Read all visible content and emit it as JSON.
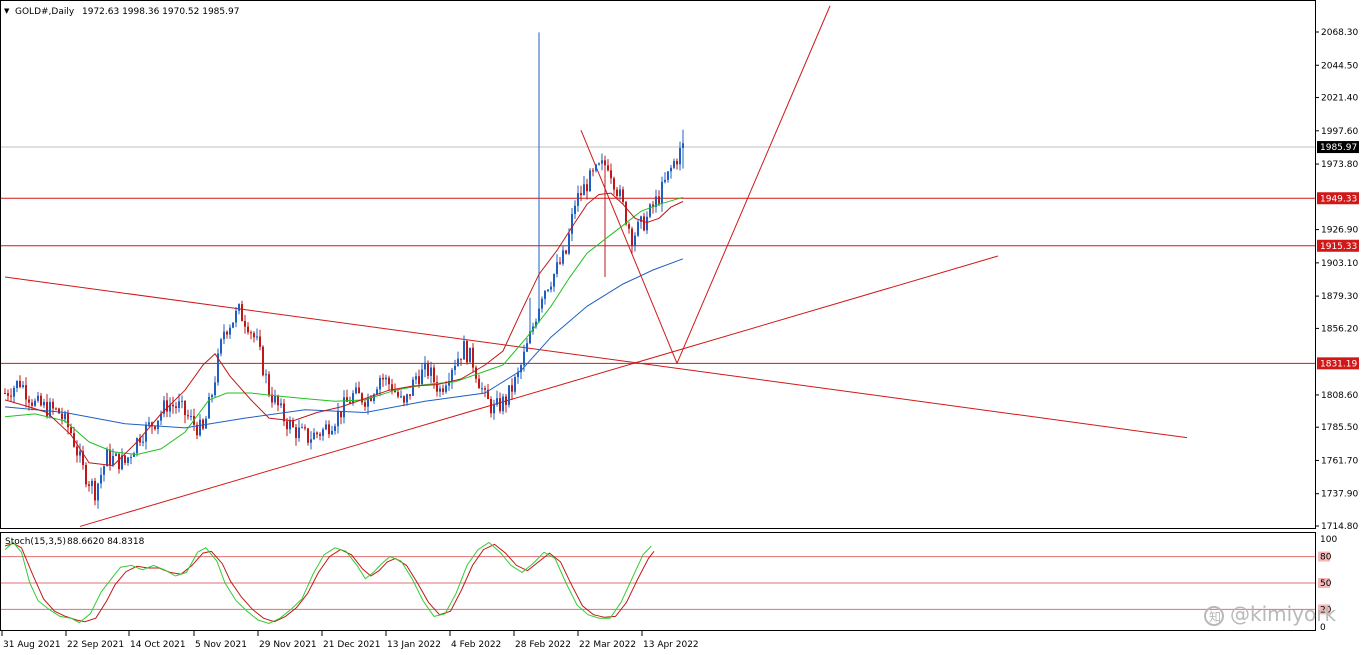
{
  "header": {
    "symbol": "GOLD#,Daily",
    "ohlc": "1972.63 1998.36 1970.52 1985.97",
    "dropdown_glyph": "▼"
  },
  "indicator": {
    "label": "Stoch(15,3,5)",
    "values": "88.6620 84.8318",
    "ticks": [
      "100",
      "80",
      "50",
      "20",
      "0"
    ]
  },
  "watermark": {
    "text": "@kimiyork",
    "logo_icon": "zhihu-circle-icon"
  },
  "colors": {
    "bull": "#1f5fc2",
    "bear": "#c01818",
    "level_line": "#d01818",
    "ma_fast": "#c01818",
    "ma_mid": "#22c022",
    "ma_slow": "#1f5fc2",
    "stoch_main": "#33cc33",
    "stoch_signal": "#c01818",
    "stoch_level": "#e07070"
  },
  "chart_data": [
    {
      "type": "candlestick",
      "ylim": [
        1714.8,
        2068.3
      ],
      "y_ticks": [
        "2068.30",
        "2044.50",
        "2021.40",
        "1997.60",
        "1973.80",
        "1949.33",
        "1926.90",
        "1903.10",
        "1879.30",
        "1856.20",
        "1831.19",
        "1808.60",
        "1785.50",
        "1761.70",
        "1737.90",
        "1714.80"
      ],
      "current_price": {
        "value": 1985.97,
        "label": "1985.97"
      },
      "levels": [
        {
          "value": 1949.33,
          "label": "1949.33"
        },
        {
          "value": 1915.33,
          "label": "1915.33"
        },
        {
          "value": 1831.19,
          "label": "1831.19"
        }
      ],
      "x_labels": [
        "31 Aug 2021",
        "22 Sep 2021",
        "14 Oct 2021",
        "5 Nov 2021",
        "29 Nov 2021",
        "21 Dec 2021",
        "13 Jan 2022",
        "4 Feb 2022",
        "28 Feb 2022",
        "22 Mar 2022",
        "13 Apr 2022"
      ],
      "trend_lines": [
        {
          "name": "descending",
          "from": {
            "bar": 0,
            "y": 1893.0
          },
          "to": {
            "bar": 394,
            "y": 1778.0
          }
        },
        {
          "name": "ascending",
          "from": {
            "bar": 25,
            "y": 1714.5
          },
          "to": {
            "bar": 331,
            "y": 1908.0
          }
        },
        {
          "name": "projection-down",
          "from": {
            "bar": 192,
            "y": 1998.0
          },
          "to": {
            "bar": 224,
            "y": 1831.19
          }
        },
        {
          "name": "projection-up",
          "from": {
            "bar": 224,
            "y": 1831.19
          },
          "to": {
            "bar": 275,
            "y": 2087.0
          }
        }
      ],
      "ma_fast": [
        [
          0,
          1805
        ],
        [
          8,
          1800
        ],
        [
          14,
          1796
        ],
        [
          22,
          1780
        ],
        [
          28,
          1760
        ],
        [
          36,
          1758
        ],
        [
          44,
          1775
        ],
        [
          52,
          1795
        ],
        [
          60,
          1812
        ],
        [
          66,
          1830
        ],
        [
          70,
          1838
        ],
        [
          75,
          1822
        ],
        [
          82,
          1805
        ],
        [
          88,
          1792
        ],
        [
          96,
          1790
        ],
        [
          104,
          1796
        ],
        [
          112,
          1800
        ],
        [
          120,
          1806
        ],
        [
          128,
          1812
        ],
        [
          136,
          1815
        ],
        [
          144,
          1816
        ],
        [
          152,
          1820
        ],
        [
          160,
          1830
        ],
        [
          166,
          1840
        ],
        [
          172,
          1868
        ],
        [
          178,
          1895
        ],
        [
          184,
          1912
        ],
        [
          190,
          1932
        ],
        [
          194,
          1945
        ],
        [
          198,
          1952
        ],
        [
          202,
          1953
        ],
        [
          206,
          1945
        ],
        [
          210,
          1935
        ],
        [
          214,
          1932
        ],
        [
          218,
          1935
        ],
        [
          222,
          1943
        ],
        [
          226,
          1947
        ]
      ],
      "ma_mid": [
        [
          0,
          1793
        ],
        [
          10,
          1795
        ],
        [
          20,
          1790
        ],
        [
          28,
          1775
        ],
        [
          36,
          1768
        ],
        [
          44,
          1766
        ],
        [
          52,
          1770
        ],
        [
          60,
          1782
        ],
        [
          68,
          1805
        ],
        [
          74,
          1810
        ],
        [
          82,
          1810
        ],
        [
          90,
          1808
        ],
        [
          100,
          1806
        ],
        [
          110,
          1804
        ],
        [
          120,
          1805
        ],
        [
          130,
          1812
        ],
        [
          140,
          1816
        ],
        [
          150,
          1818
        ],
        [
          158,
          1824
        ],
        [
          166,
          1830
        ],
        [
          174,
          1850
        ],
        [
          182,
          1872
        ],
        [
          188,
          1892
        ],
        [
          194,
          1910
        ],
        [
          200,
          1920
        ],
        [
          206,
          1930
        ],
        [
          212,
          1940
        ],
        [
          218,
          1945
        ],
        [
          226,
          1950
        ]
      ],
      "ma_slow": [
        [
          0,
          1800
        ],
        [
          20,
          1796
        ],
        [
          40,
          1788
        ],
        [
          60,
          1785
        ],
        [
          80,
          1792
        ],
        [
          100,
          1798
        ],
        [
          120,
          1796
        ],
        [
          140,
          1804
        ],
        [
          160,
          1810
        ],
        [
          172,
          1826
        ],
        [
          182,
          1850
        ],
        [
          194,
          1872
        ],
        [
          206,
          1888
        ],
        [
          216,
          1898
        ],
        [
          226,
          1906
        ]
      ],
      "bars": {
        "count": 227,
        "anchors": [
          [
            0,
            1810
          ],
          [
            5,
            1818
          ],
          [
            10,
            1802
          ],
          [
            18,
            1796
          ],
          [
            22,
            1782
          ],
          [
            26,
            1755
          ],
          [
            30,
            1740
          ],
          [
            34,
            1764
          ],
          [
            40,
            1760
          ],
          [
            45,
            1780
          ],
          [
            50,
            1790
          ],
          [
            54,
            1802
          ],
          [
            58,
            1800
          ],
          [
            62,
            1790
          ],
          [
            66,
            1782
          ],
          [
            69,
            1810
          ],
          [
            73,
            1855
          ],
          [
            78,
            1868
          ],
          [
            81,
            1860
          ],
          [
            84,
            1845
          ],
          [
            88,
            1812
          ],
          [
            93,
            1792
          ],
          [
            96,
            1784
          ],
          [
            101,
            1778
          ],
          [
            106,
            1783
          ],
          [
            110,
            1792
          ],
          [
            116,
            1808
          ],
          [
            121,
            1806
          ],
          [
            125,
            1822
          ],
          [
            129,
            1815
          ],
          [
            133,
            1800
          ],
          [
            137,
            1822
          ],
          [
            141,
            1826
          ],
          [
            145,
            1812
          ],
          [
            149,
            1830
          ],
          [
            153,
            1842
          ],
          [
            156,
            1832
          ],
          [
            160,
            1806
          ],
          [
            163,
            1798
          ],
          [
            167,
            1805
          ],
          [
            171,
            1822
          ],
          [
            175,
            1850
          ],
          [
            179,
            1882
          ],
          [
            183,
            1895
          ],
          [
            187,
            1910
          ],
          [
            190,
            1946
          ],
          [
            194,
            1960
          ],
          [
            198,
            1970
          ],
          [
            201,
            1975
          ],
          [
            205,
            1950
          ],
          [
            209,
            1922
          ],
          [
            214,
            1935
          ],
          [
            219,
            1955
          ],
          [
            223,
            1975
          ],
          [
            226,
            1986
          ]
        ]
      }
    },
    {
      "type": "line",
      "name": "Stoch(15,3,5)",
      "ylim": [
        0,
        100
      ],
      "levels": [
        80,
        50,
        20
      ],
      "series_main": [
        [
          0,
          88
        ],
        [
          3,
          96
        ],
        [
          6,
          85
        ],
        [
          9,
          50
        ],
        [
          12,
          30
        ],
        [
          16,
          20
        ],
        [
          20,
          12
        ],
        [
          24,
          10
        ],
        [
          27,
          5
        ],
        [
          31,
          15
        ],
        [
          35,
          40
        ],
        [
          38,
          52
        ],
        [
          42,
          68
        ],
        [
          46,
          70
        ],
        [
          50,
          65
        ],
        [
          54,
          70
        ],
        [
          58,
          65
        ],
        [
          62,
          58
        ],
        [
          66,
          62
        ],
        [
          70,
          85
        ],
        [
          73,
          90
        ],
        [
          77,
          75
        ],
        [
          80,
          50
        ],
        [
          84,
          30
        ],
        [
          88,
          18
        ],
        [
          92,
          8
        ],
        [
          96,
          4
        ],
        [
          100,
          10
        ],
        [
          104,
          20
        ],
        [
          108,
          32
        ],
        [
          112,
          60
        ],
        [
          116,
          82
        ],
        [
          120,
          90
        ],
        [
          124,
          86
        ],
        [
          128,
          70
        ],
        [
          131,
          55
        ],
        [
          134,
          62
        ],
        [
          137,
          72
        ],
        [
          140,
          80
        ],
        [
          144,
          75
        ],
        [
          148,
          55
        ],
        [
          152,
          30
        ],
        [
          156,
          12
        ],
        [
          160,
          15
        ],
        [
          164,
          38
        ],
        [
          168,
          70
        ],
        [
          172,
          88
        ],
        [
          176,
          96
        ],
        [
          180,
          85
        ],
        [
          184,
          70
        ],
        [
          188,
          62
        ],
        [
          192,
          72
        ],
        [
          196,
          85
        ],
        [
          200,
          78
        ],
        [
          204,
          50
        ],
        [
          208,
          25
        ],
        [
          212,
          14
        ],
        [
          216,
          10
        ],
        [
          220,
          10
        ],
        [
          224,
          28
        ],
        [
          228,
          55
        ],
        [
          232,
          82
        ],
        [
          235,
          92
        ]
      ],
      "series_signal": [
        [
          0,
          92
        ],
        [
          3,
          95
        ],
        [
          6,
          90
        ],
        [
          10,
          60
        ],
        [
          14,
          32
        ],
        [
          18,
          18
        ],
        [
          22,
          12
        ],
        [
          26,
          8
        ],
        [
          29,
          6
        ],
        [
          33,
          10
        ],
        [
          37,
          30
        ],
        [
          40,
          48
        ],
        [
          44,
          63
        ],
        [
          48,
          69
        ],
        [
          52,
          67
        ],
        [
          56,
          67
        ],
        [
          60,
          62
        ],
        [
          64,
          60
        ],
        [
          68,
          70
        ],
        [
          72,
          84
        ],
        [
          75,
          86
        ],
        [
          79,
          72
        ],
        [
          82,
          52
        ],
        [
          86,
          34
        ],
        [
          90,
          20
        ],
        [
          94,
          10
        ],
        [
          98,
          6
        ],
        [
          102,
          12
        ],
        [
          106,
          22
        ],
        [
          110,
          38
        ],
        [
          114,
          62
        ],
        [
          118,
          80
        ],
        [
          122,
          88
        ],
        [
          126,
          82
        ],
        [
          130,
          66
        ],
        [
          133,
          58
        ],
        [
          136,
          64
        ],
        [
          139,
          74
        ],
        [
          142,
          78
        ],
        [
          146,
          70
        ],
        [
          150,
          50
        ],
        [
          154,
          28
        ],
        [
          158,
          14
        ],
        [
          162,
          18
        ],
        [
          166,
          42
        ],
        [
          170,
          70
        ],
        [
          174,
          88
        ],
        [
          178,
          94
        ],
        [
          182,
          84
        ],
        [
          186,
          70
        ],
        [
          190,
          64
        ],
        [
          194,
          74
        ],
        [
          198,
          84
        ],
        [
          202,
          74
        ],
        [
          206,
          48
        ],
        [
          210,
          24
        ],
        [
          214,
          14
        ],
        [
          218,
          11
        ],
        [
          222,
          12
        ],
        [
          226,
          28
        ],
        [
          230,
          54
        ],
        [
          234,
          78
        ],
        [
          236,
          86
        ]
      ]
    }
  ]
}
